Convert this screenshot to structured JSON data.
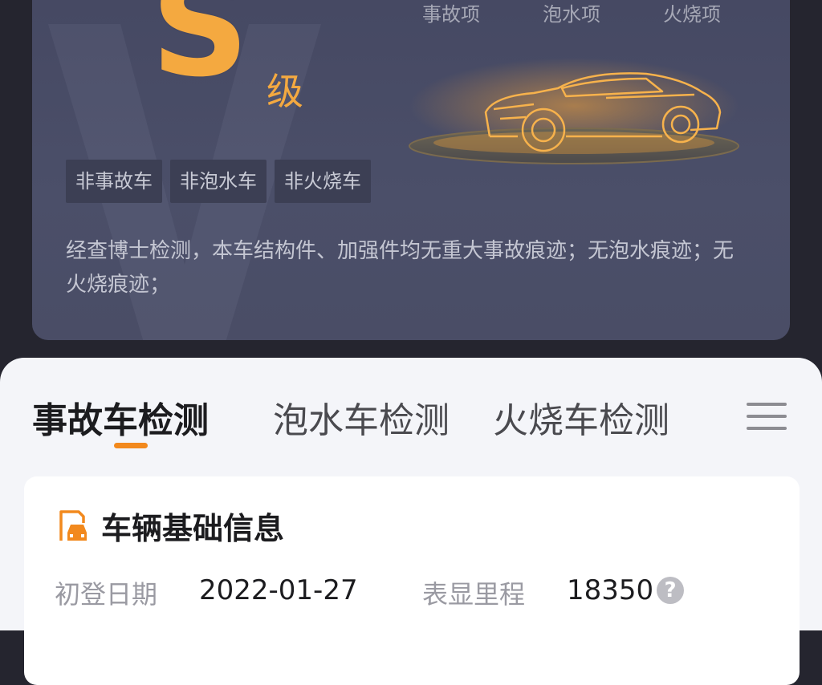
{
  "report": {
    "grade_letter": "S",
    "grade_suffix": "级",
    "check_headers": [
      "事故项",
      "泡水项",
      "火烧项"
    ],
    "tags": [
      "非事故车",
      "非泡水车",
      "非火烧车"
    ],
    "summary": "经查博士检测，本车结构件、加强件均无重大事故痕迹；无泡水痕迹；无火烧痕迹；"
  },
  "tabs": [
    {
      "label": "事故车检测",
      "active": true
    },
    {
      "label": "泡水车检测",
      "active": false
    },
    {
      "label": "火烧车检测",
      "active": false
    }
  ],
  "menu_icon": "menu-icon",
  "vehicle_info": {
    "title": "车辆基础信息",
    "title_icon": "car-document-icon",
    "fields": [
      {
        "label": "初登日期",
        "value": "2022-01-27"
      },
      {
        "label": "表显里程",
        "value": "18350",
        "help_icon": "?"
      }
    ]
  },
  "colors": {
    "accent": "#f4a940",
    "tab_indicator": "#f2891d",
    "card_bg": "#4a4d66",
    "page_bg": "#25252f",
    "sheet_bg": "#f4f5f9"
  }
}
